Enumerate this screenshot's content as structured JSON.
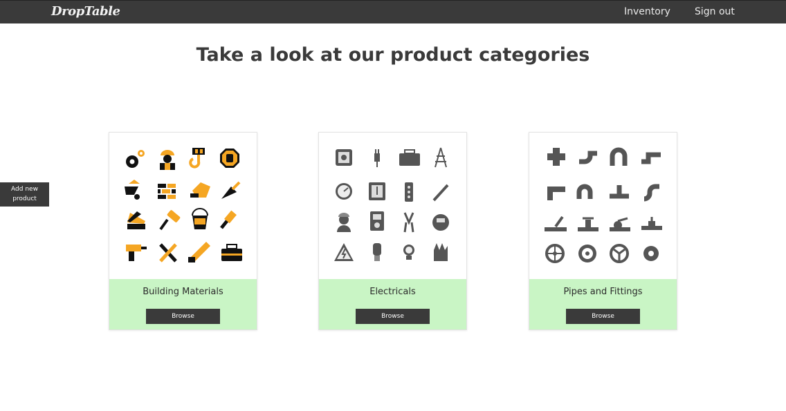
{
  "nav": {
    "brand": "DropTable",
    "links": [
      "Inventory",
      "Sign out"
    ]
  },
  "page": {
    "title": "Take a look at our product categories",
    "add_new_label": "Add new product"
  },
  "categories": [
    {
      "name": "Building Materials",
      "button": "Browse",
      "icon_style": "black-and-orange-construction-icons"
    },
    {
      "name": "Electricals",
      "button": "Browse",
      "icon_style": "gray-electrical-icons"
    },
    {
      "name": "Pipes and Fittings",
      "button": "Browse",
      "icon_style": "gray-pipe-fitting-icons"
    }
  ],
  "colors": {
    "navbar": "#3a3a3a",
    "card_footer": "#c9f5c5",
    "button": "#3a3a3a",
    "accent_orange": "#f5a623"
  }
}
